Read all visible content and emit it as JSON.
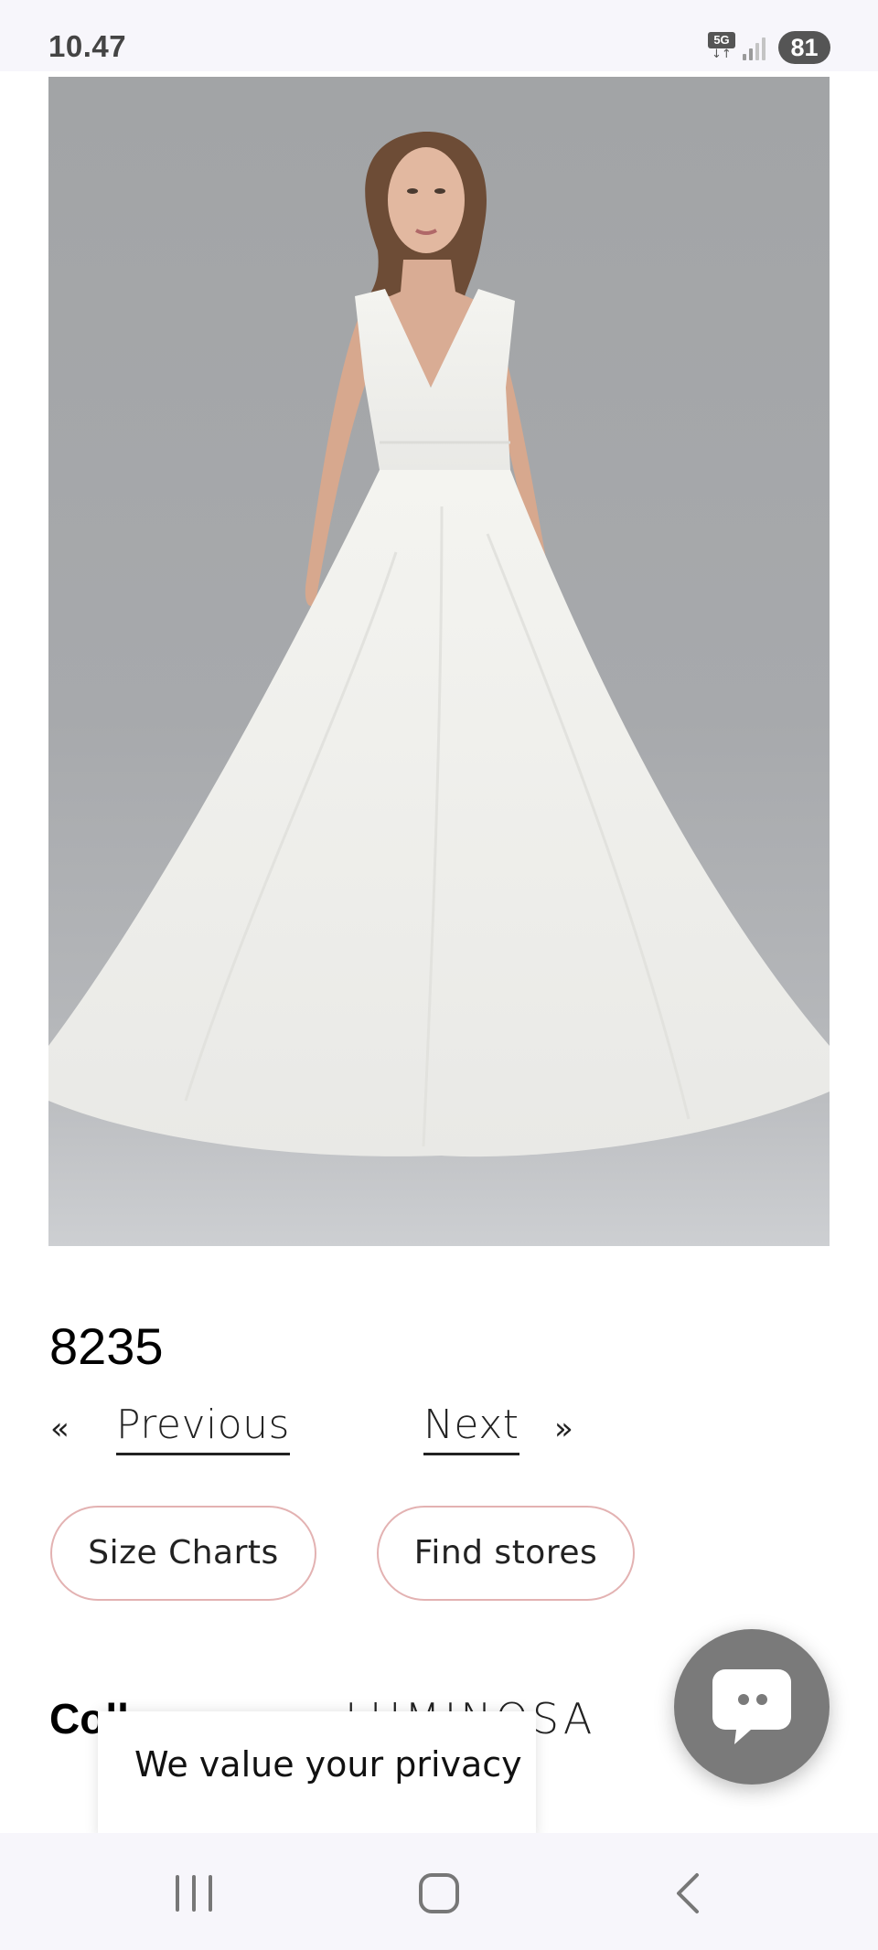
{
  "status_bar": {
    "time": "10.47",
    "network": "5G",
    "network_arrows": "↓↑",
    "battery": "81",
    "icons": [
      "5g-icon",
      "signal-icon",
      "battery-icon"
    ]
  },
  "product": {
    "image_alt": "wedding-dress-photo",
    "title": "8235"
  },
  "navigation": {
    "prev_arrow": "«",
    "prev_label": "Previous",
    "next_label": "Next",
    "next_arrow": "»"
  },
  "buttons": {
    "size_charts": "Size Charts",
    "find_stores": "Find stores"
  },
  "details": {
    "collection_label": "Coll",
    "collection_value": "LUMINOSA"
  },
  "privacy": {
    "text": "We value your privacy"
  },
  "chat": {
    "icon": "chat-icon"
  },
  "system_nav": {
    "icons": [
      "recent-apps-icon",
      "home-icon",
      "back-icon"
    ]
  },
  "colors": {
    "pill_border": "#e3b2b2",
    "chat_bg": "#7a7a7a",
    "photo_bg": "#a7a9ac"
  }
}
